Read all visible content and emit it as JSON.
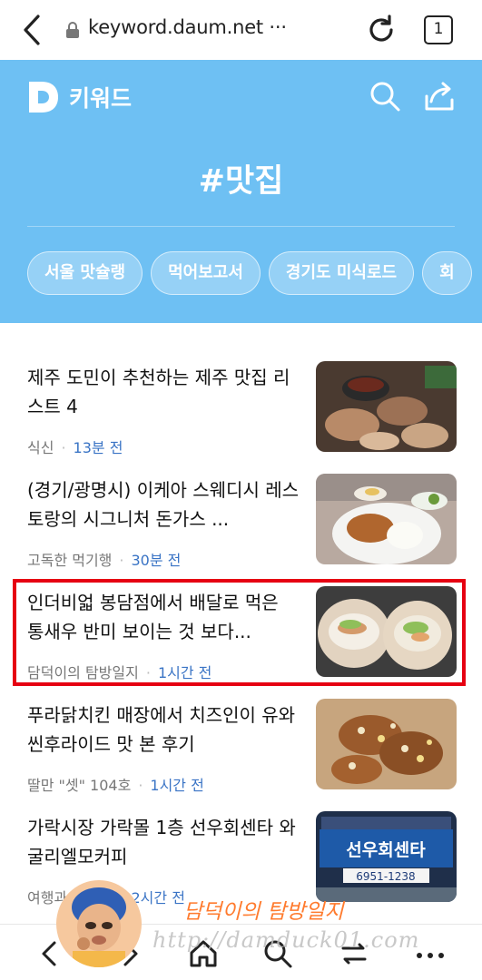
{
  "browser": {
    "url": "keyword.daum.net ···",
    "tab_count": "1"
  },
  "header": {
    "logo_text": "키워드",
    "keyword": "#맛집",
    "chips": [
      "서울 맛슐랭",
      "먹어보고서",
      "경기도 미식로드",
      "회"
    ]
  },
  "items": [
    {
      "title": "제주 도민이 추천하는 제주 맛집 리스트 4",
      "source": "식신",
      "time": "13분 전"
    },
    {
      "title": "(경기/광명시) 이케아 스웨디시 레스토랑의 시그니처 돈가스 ...",
      "source": "고독한 먹기행",
      "time": "30분 전"
    },
    {
      "title": "인더비얿 봉담점에서 배달로 먹은 통새우 반미 보이는 것 보다...",
      "source": "담덕이의 탐방일지",
      "time": "1시간 전"
    },
    {
      "title": "푸라닭치킨 매장에서 치즈인이 유와 씬후라이드 맛 본 후기",
      "source": "딸만 \"셋\" 104호",
      "time": "1시간 전"
    },
    {
      "title": "가락시장 가락몰 1층 선우회센타 와 굴리엘모커피",
      "source": "여행과의 추억",
      "time": "2시간 전"
    }
  ],
  "thumb_signs": {
    "store_name": "선우회센타",
    "phone": "6951-1238"
  },
  "watermark": {
    "name": "담덕이의 탐방일지",
    "url": "http://damduck01.com"
  },
  "colors": {
    "header_bg": "#6ec0f3",
    "time_text": "#3a74c5",
    "highlight": "#e60012",
    "watermark_name": "#ff7b2e"
  }
}
